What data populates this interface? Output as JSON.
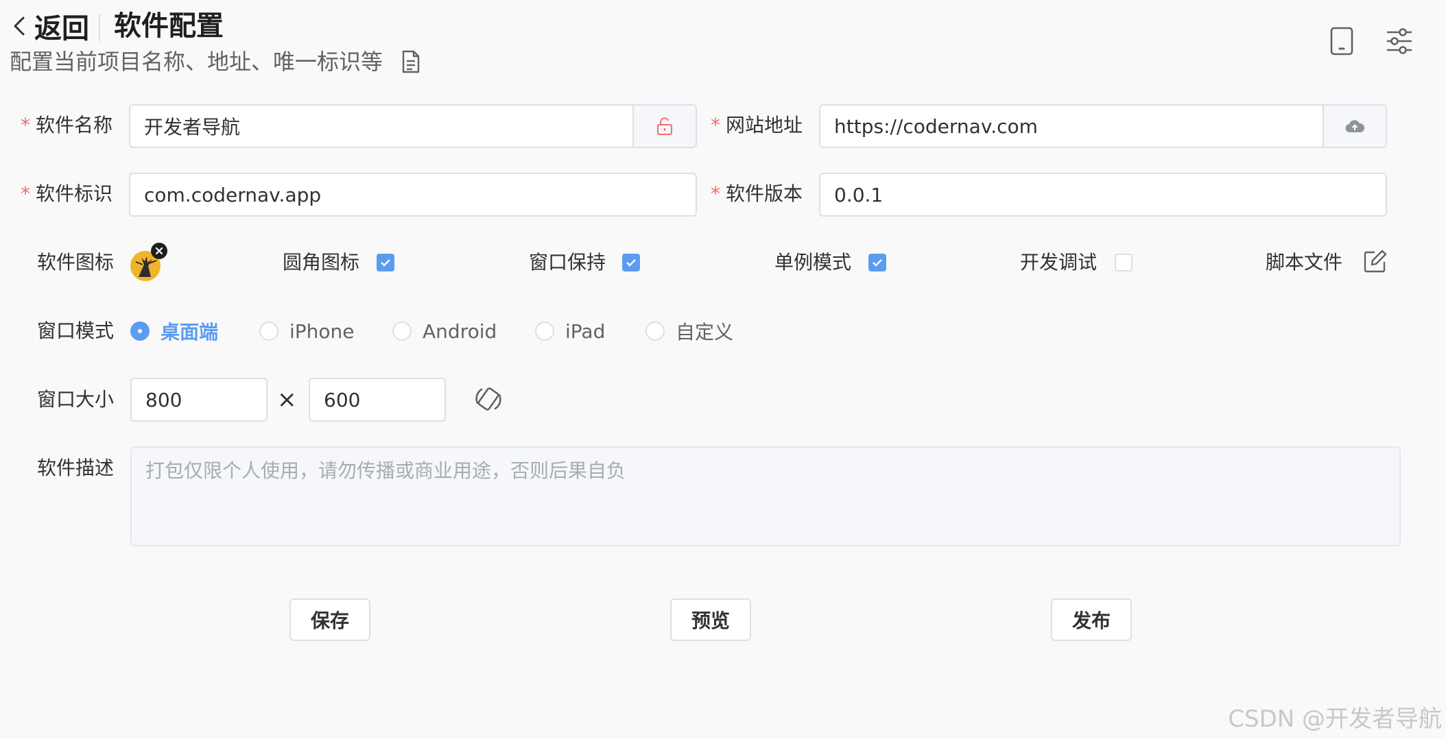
{
  "header": {
    "back_label": "返回",
    "title": "软件配置",
    "subtitle": "配置当前项目名称、地址、唯一标识等"
  },
  "icons": {
    "doc": "document-icon",
    "device": "tablet-icon",
    "settings": "sliders-icon",
    "lock": "unlock-icon",
    "upload": "cloud-upload-icon",
    "edit": "edit-icon",
    "rotate": "rotate-icon",
    "remove": "close-icon"
  },
  "form": {
    "name": {
      "label": "软件名称",
      "value": "开发者导航"
    },
    "url": {
      "label": "网站地址",
      "value": "https://codernav.com"
    },
    "id": {
      "label": "软件标识",
      "value": "com.codernav.app"
    },
    "version": {
      "label": "软件版本",
      "value": "0.0.1"
    },
    "required_mark": "*",
    "icon_label": "软件图标",
    "options": [
      {
        "label": "圆角图标",
        "checked": true
      },
      {
        "label": "窗口保持",
        "checked": true
      },
      {
        "label": "单例模式",
        "checked": true
      },
      {
        "label": "开发调试",
        "checked": false
      }
    ],
    "script_label": "脚本文件",
    "window_mode": {
      "label": "窗口模式",
      "options": [
        "桌面端",
        "iPhone",
        "Android",
        "iPad",
        "自定义"
      ],
      "selected": "桌面端"
    },
    "window_size": {
      "label": "窗口大小",
      "width": "800",
      "height": "600",
      "separator": "×"
    },
    "desc": {
      "label": "软件描述",
      "placeholder": "打包仅限个人使用，请勿传播或商业用途，否则后果自负"
    }
  },
  "actions": {
    "save": "保存",
    "preview": "预览",
    "publish": "发布"
  },
  "watermark": "CSDN @开发者导航",
  "colors": {
    "accent": "#5b9cf0",
    "required": "#f56c6c",
    "border": "#dcdfe6"
  }
}
